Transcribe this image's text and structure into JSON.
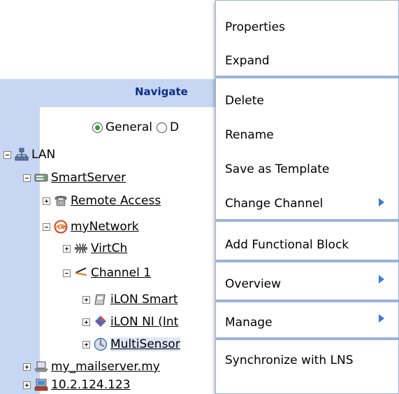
{
  "navigator": {
    "title": "Navigate",
    "radio_options": [
      {
        "label": "General",
        "checked": true
      },
      {
        "label": "D",
        "checked": false
      }
    ],
    "tree": [
      {
        "label": "LAN",
        "icon": "lan-icon",
        "toggle": "minus",
        "link": false
      },
      {
        "label": "SmartServer",
        "icon": "server-icon",
        "toggle": "minus",
        "link": true
      },
      {
        "label": "Remote Access",
        "icon": "phone-icon",
        "toggle": "plus",
        "link": true
      },
      {
        "label": "myNetwork",
        "icon": "network-icon",
        "toggle": "minus",
        "link": true
      },
      {
        "label": "VirtCh",
        "icon": "virtual-channel-icon",
        "toggle": "plus",
        "link": true
      },
      {
        "label": "Channel 1",
        "icon": "channel-icon",
        "toggle": "minus",
        "link": true
      },
      {
        "label": "iLON Smart",
        "icon": "device-icon",
        "toggle": "plus",
        "link": true
      },
      {
        "label": "iLON NI (Int",
        "icon": "interface-icon",
        "toggle": "plus",
        "link": true
      },
      {
        "label": "MultiSensor",
        "icon": "sensor-icon",
        "toggle": "plus",
        "link": true,
        "selected": true
      },
      {
        "label": "my_mailserver.my",
        "icon": "laptop-icon",
        "toggle": "plus",
        "link": true
      },
      {
        "label": "10.2.124.123",
        "icon": "computer-icon",
        "toggle": "plus",
        "link": true
      }
    ]
  },
  "context_menu": {
    "items": [
      {
        "label": "Properties",
        "submenu": false
      },
      {
        "label": "Expand",
        "submenu": false
      },
      {
        "label": "Delete",
        "submenu": false
      },
      {
        "label": "Rename",
        "submenu": false
      },
      {
        "label": "Save as Template",
        "submenu": false
      },
      {
        "label": "Change Channel",
        "submenu": true
      },
      {
        "label": "Add Functional Block",
        "submenu": false
      },
      {
        "label": "Overview",
        "submenu": true
      },
      {
        "label": "Manage",
        "submenu": true
      },
      {
        "label": "Synchronize with LNS",
        "submenu": false
      }
    ]
  },
  "colors": {
    "panel_bg": "#c7d6f2",
    "title_color": "#0d2f8c",
    "menu_border": "#9bb3d8",
    "submenu_arrow": "#3b7bd9"
  }
}
